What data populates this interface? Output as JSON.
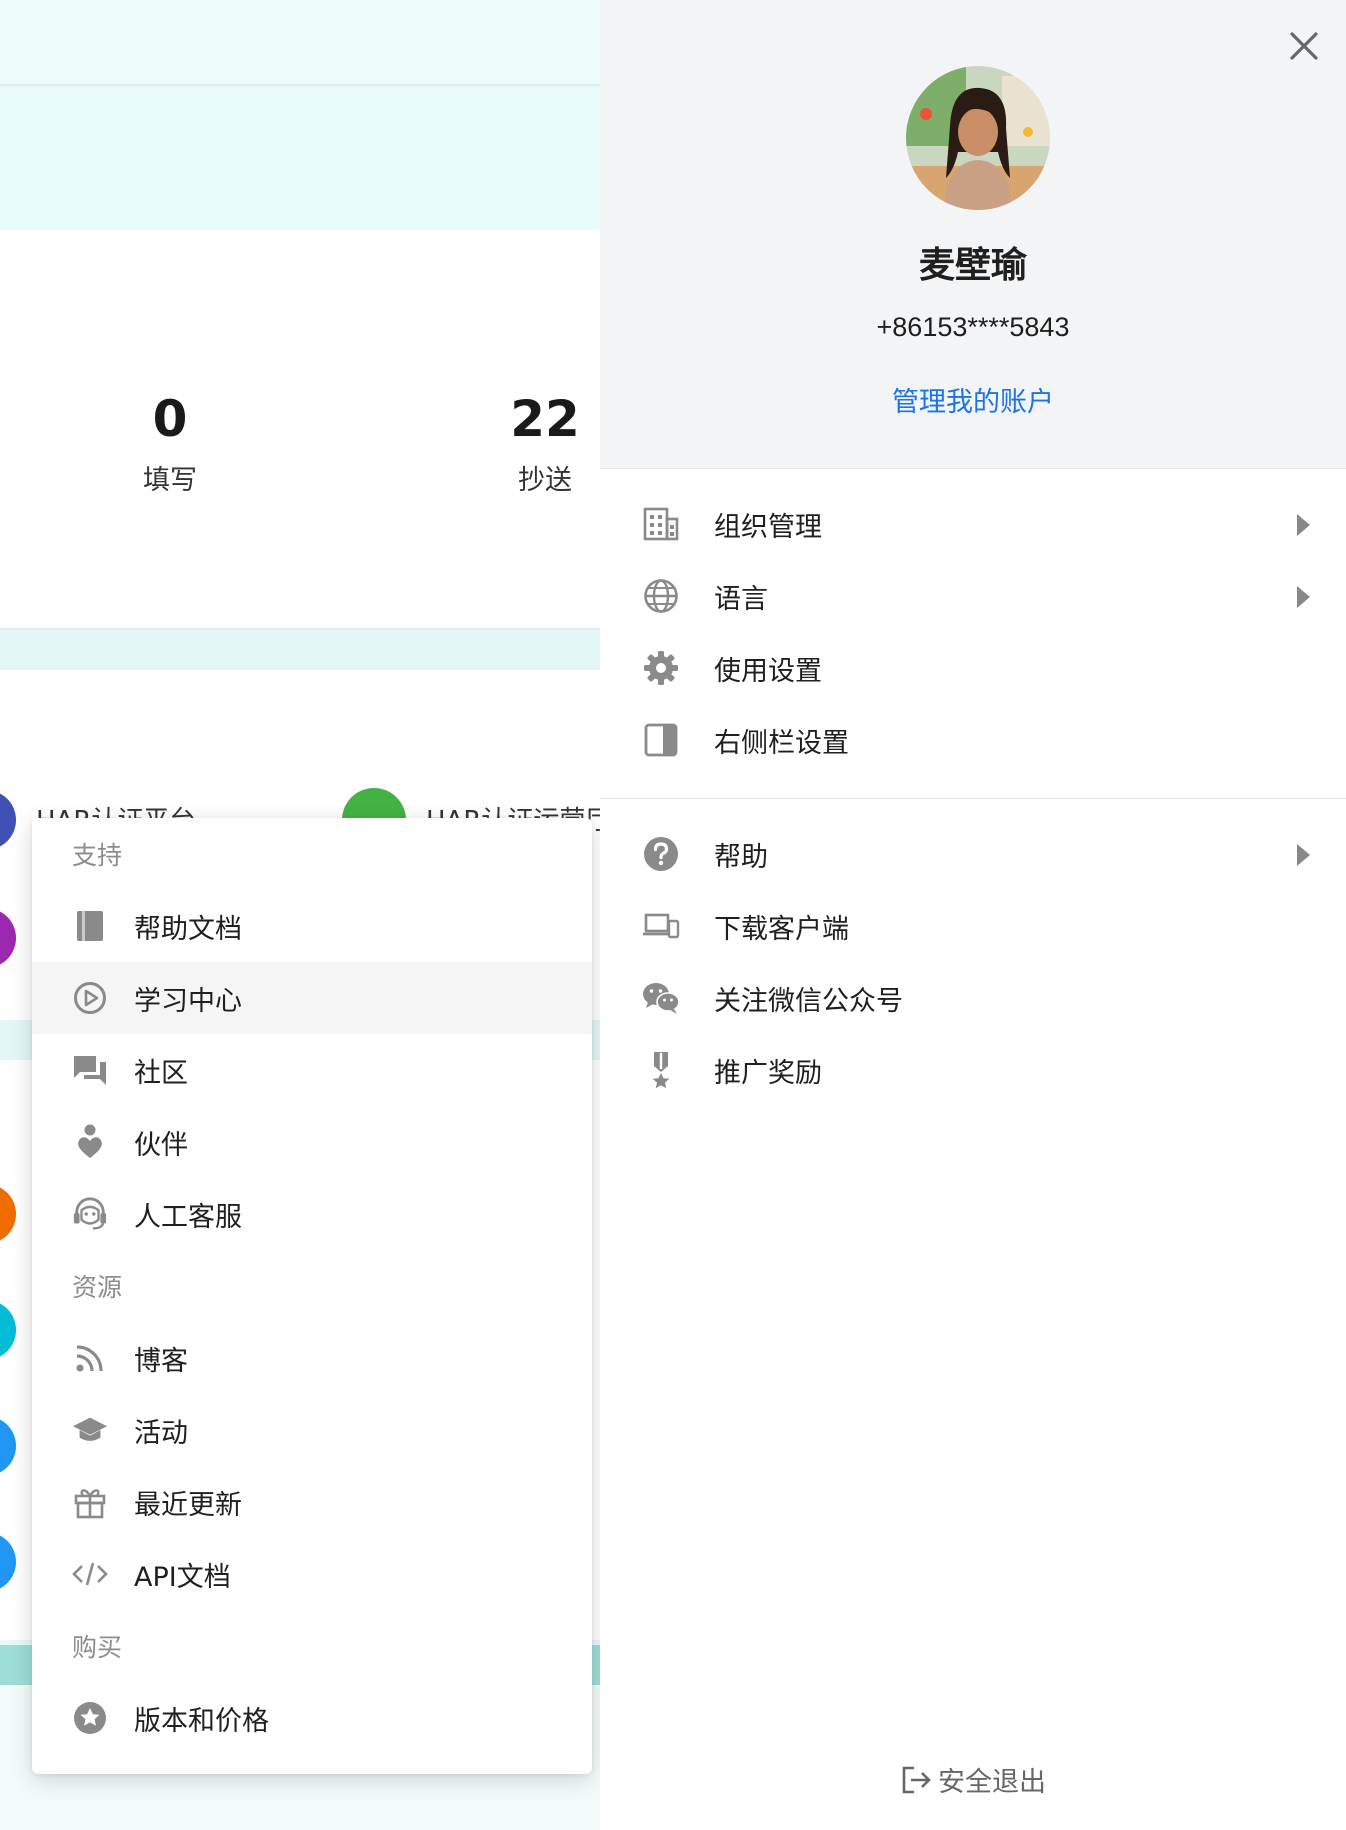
{
  "stats": [
    {
      "value": "0",
      "label": "填写"
    },
    {
      "value": "22",
      "label": "抄送"
    }
  ],
  "background_apps": [
    "HAR认证平台",
    "HAR认证运营厅"
  ],
  "dropdown": {
    "sections": [
      {
        "title": "支持",
        "items": [
          "帮助文档",
          "学习中心",
          "社区",
          "伙伴",
          "人工客服"
        ]
      },
      {
        "title": "资源",
        "items": [
          "博客",
          "活动",
          "最近更新",
          "API文档"
        ]
      },
      {
        "title": "购买",
        "items": [
          "版本和价格"
        ]
      }
    ],
    "hovered_item": "学习中心"
  },
  "profile": {
    "name": "麦壁瑜",
    "phone": "+86153****5843",
    "manage_link": "管理我的账户",
    "menu1": [
      {
        "label": "组织管理",
        "icon": "building-icon",
        "has_submenu": true
      },
      {
        "label": "语言",
        "icon": "globe-icon",
        "has_submenu": true
      },
      {
        "label": "使用设置",
        "icon": "gear-icon",
        "has_submenu": false
      },
      {
        "label": "右侧栏设置",
        "icon": "sidebar-icon",
        "has_submenu": false
      }
    ],
    "menu2": [
      {
        "label": "帮助",
        "icon": "question-icon",
        "has_submenu": true
      },
      {
        "label": "下载客户端",
        "icon": "devices-icon",
        "has_submenu": false
      },
      {
        "label": "关注微信公众号",
        "icon": "wechat-icon",
        "has_submenu": false
      },
      {
        "label": "推广奖励",
        "icon": "medal-icon",
        "has_submenu": false
      }
    ],
    "logout": "安全退出"
  },
  "colors": {
    "link": "#1a73e8",
    "icon_gray": "#8a8a8a",
    "panel_header_bg": "#f3f4f6"
  }
}
